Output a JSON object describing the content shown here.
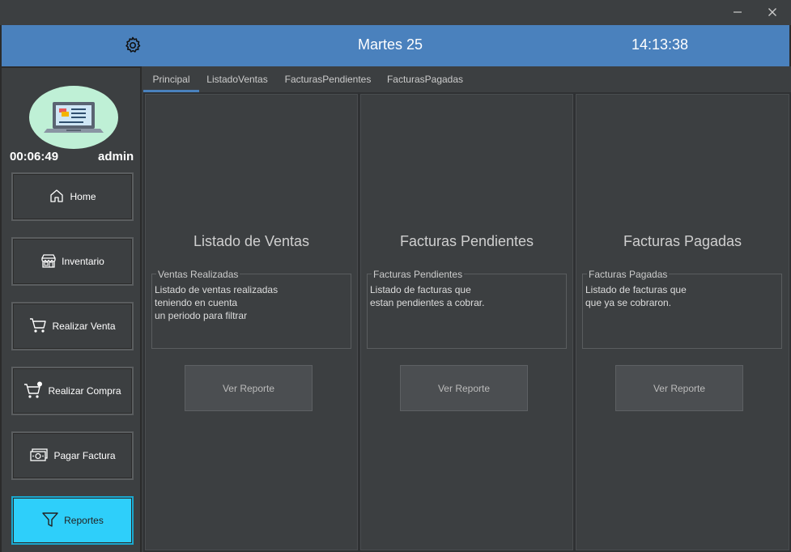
{
  "window": {
    "minimize_icon": "minimize-icon",
    "close_icon": "close-icon"
  },
  "header": {
    "settings_icon": "gear-icon",
    "date": "Martes 25",
    "time": "14:13:38",
    "background": "#4a81bd"
  },
  "sidebar": {
    "session_time": "00:06:49",
    "username": "admin",
    "items": [
      {
        "label": "Home",
        "icon": "home-icon"
      },
      {
        "label": "Inventario",
        "icon": "store-icon"
      },
      {
        "label": "Realizar Venta",
        "icon": "cart-icon"
      },
      {
        "label": "Realizar Compra",
        "icon": "cart-add-icon"
      },
      {
        "label": "Pagar Factura",
        "icon": "cash-icon"
      },
      {
        "label": "Reportes",
        "icon": "filter-icon",
        "active": true
      }
    ],
    "active_color": "#2ecffa"
  },
  "tabs": [
    {
      "label": "Principal",
      "active": true
    },
    {
      "label": "ListadoVentas"
    },
    {
      "label": "FacturasPendientes"
    },
    {
      "label": "FacturasPagadas"
    }
  ],
  "panels": [
    {
      "title": "Listado de Ventas",
      "legend": "Ventas Realizadas",
      "lines": [
        "Listado de ventas realizadas",
        "teniendo en cuenta",
        "un periodo para filtrar"
      ],
      "button": "Ver Reporte"
    },
    {
      "title": "Facturas Pendientes",
      "legend": "Facturas Pendientes",
      "lines": [
        "Listado de facturas que",
        "estan pendientes a cobrar."
      ],
      "button": "Ver Reporte"
    },
    {
      "title": "Facturas Pagadas",
      "legend": "Facturas Pagadas",
      "lines": [
        "Listado de facturas que",
        "que ya se cobraron."
      ],
      "button": "Ver Reporte"
    }
  ]
}
